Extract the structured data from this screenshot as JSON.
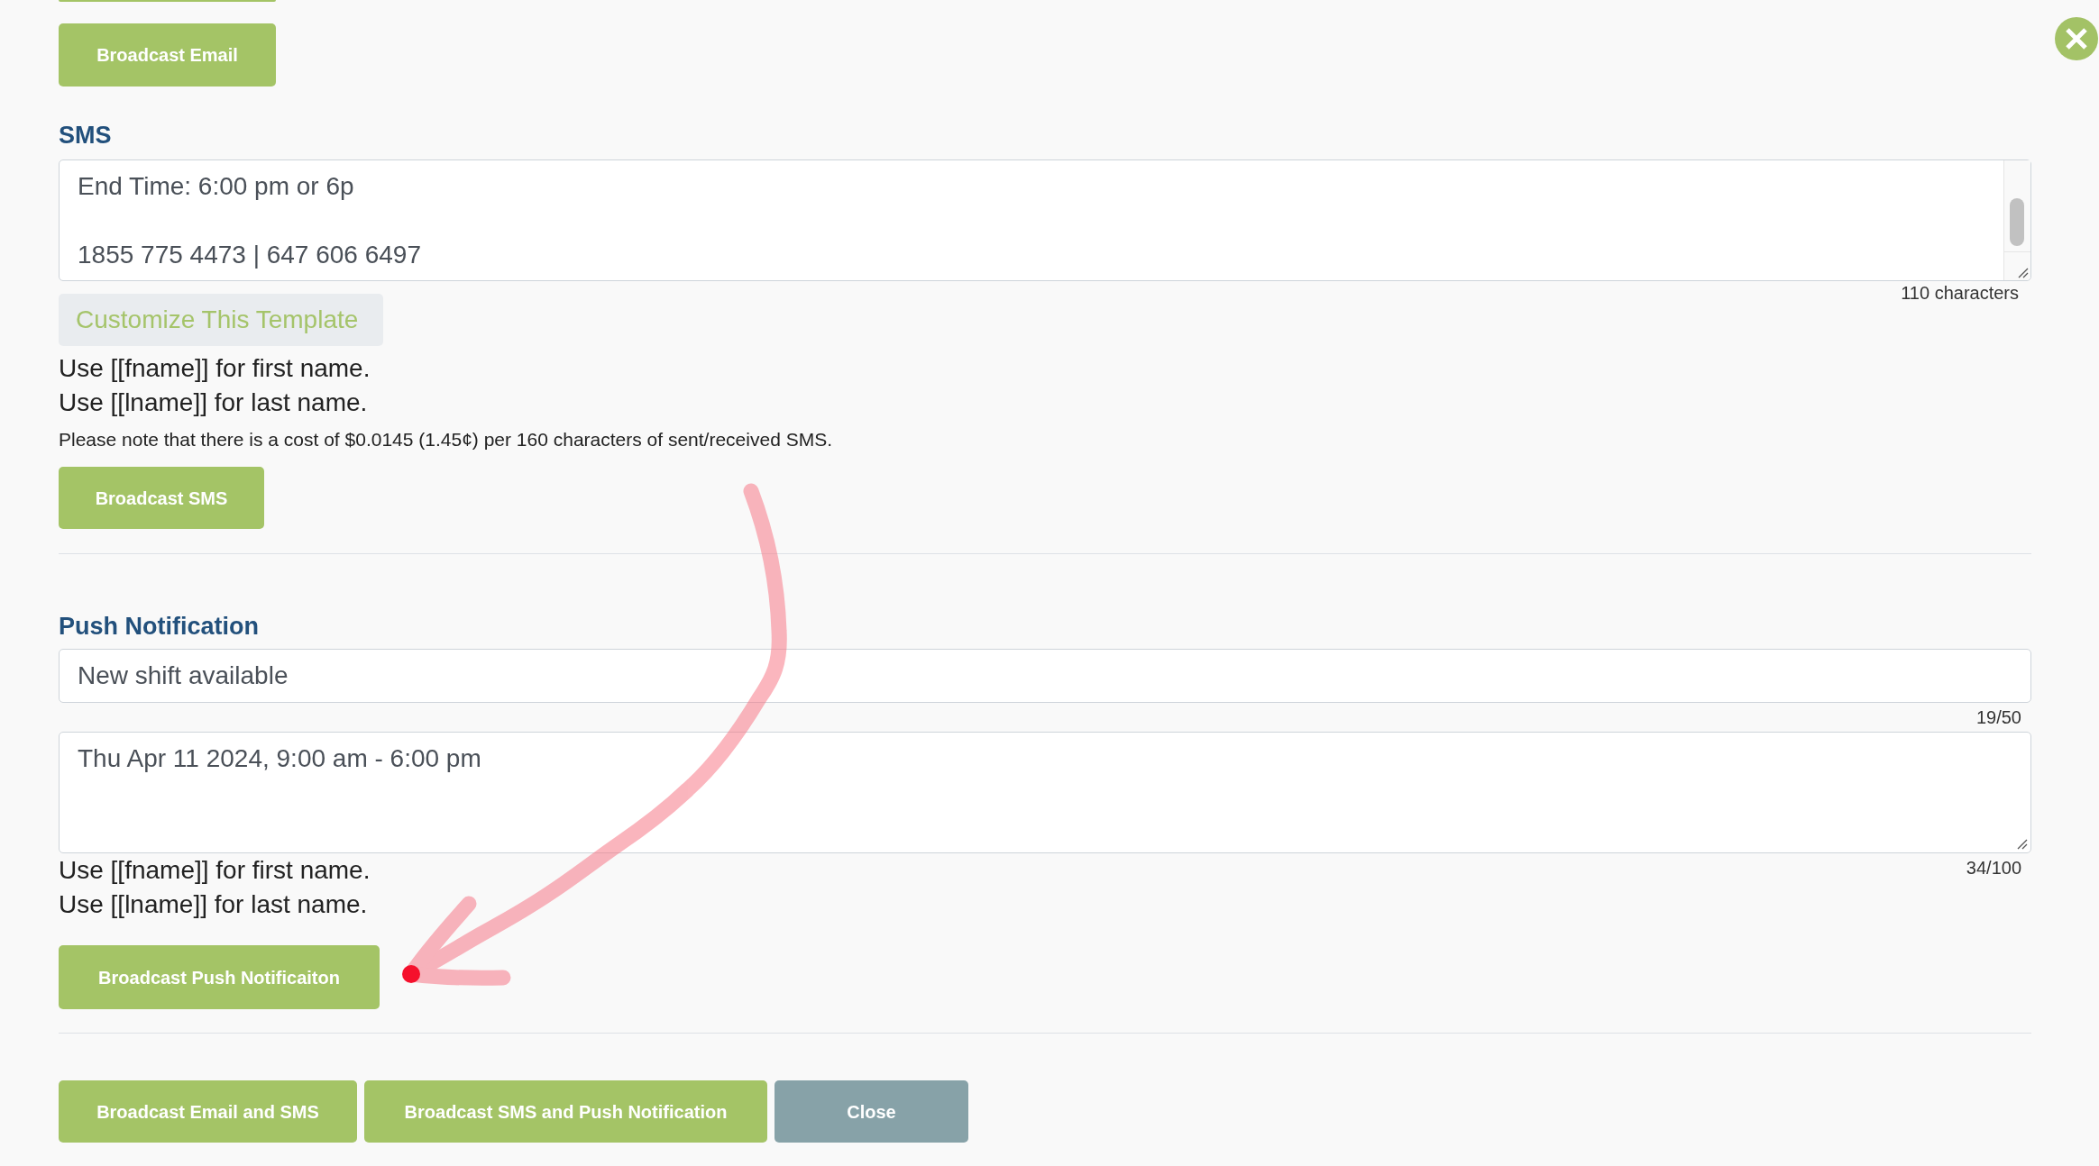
{
  "email": {
    "broadcast_button": "Broadcast Email"
  },
  "sms": {
    "heading": "SMS",
    "message": "End Time: 6:00 pm or 6p\n\n1855 775 4473 | 647 606 6497",
    "character_count": "110 characters",
    "customize_button": "Customize This Template",
    "hints": [
      "Use [[fname]] for first name.",
      "Use [[lname]] for last name."
    ],
    "cost_note": "Please note that there is a cost of $0.0145 (1.45¢) per 160 characters of sent/received SMS.",
    "broadcast_button": "Broadcast SMS"
  },
  "push_notification": {
    "heading": "Push Notification",
    "title": {
      "value": "New shift available",
      "count": "19/50"
    },
    "body": {
      "value": "Thu Apr 11 2024, 9:00 am - 6:00 pm",
      "count": "34/100"
    },
    "hints": [
      "Use [[fname]] for first name.",
      "Use [[lname]] for last name."
    ],
    "broadcast_button": "Broadcast Push Notificaiton"
  },
  "footer_buttons": [
    {
      "label": "Broadcast Email and SMS",
      "kind": "primary"
    },
    {
      "label": "Broadcast SMS and Push Notification",
      "kind": "primary"
    },
    {
      "label": "Close",
      "kind": "secondary"
    }
  ]
}
